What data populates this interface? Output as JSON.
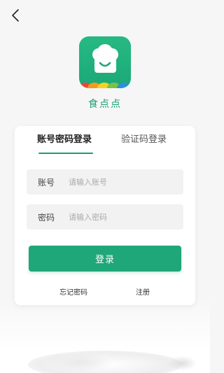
{
  "header": {
    "back_icon": "chevron-left-icon"
  },
  "app": {
    "name": "食点点",
    "logo_icon": "chef-hat-icon",
    "brand_color": "#1fa679"
  },
  "tabs": [
    {
      "label": "账号密码登录",
      "active": true
    },
    {
      "label": "验证码登录",
      "active": false
    }
  ],
  "form": {
    "account": {
      "label": "账号",
      "placeholder": "请输入账号",
      "value": ""
    },
    "password": {
      "label": "密码",
      "placeholder": "请输入密码",
      "value": ""
    },
    "submit_label": "登录"
  },
  "links": {
    "forgot_password": "忘记密码",
    "register": "注册"
  }
}
